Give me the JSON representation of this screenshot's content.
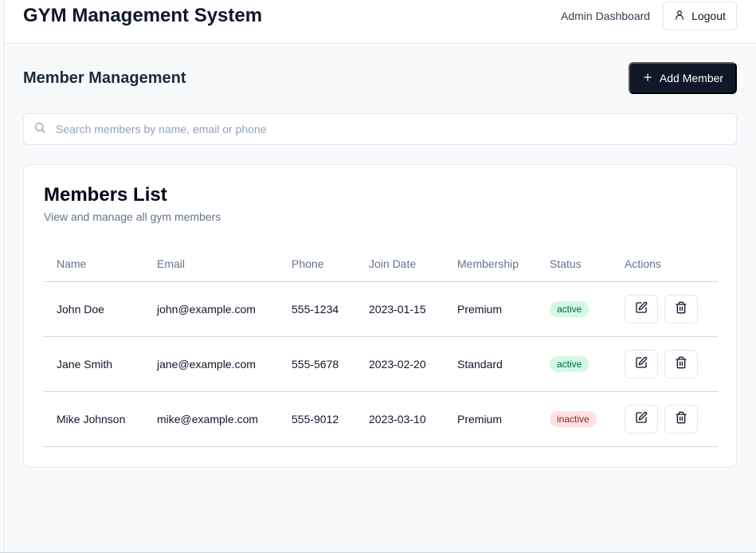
{
  "header": {
    "app_title": "GYM Management System",
    "admin_label": "Admin Dashboard",
    "logout_label": "Logout"
  },
  "page": {
    "title": "Member Management",
    "add_member_label": "Add Member"
  },
  "search": {
    "placeholder": "Search members by name, email or phone",
    "value": ""
  },
  "members_card": {
    "title": "Members List",
    "subtitle": "View and manage all gym members",
    "columns": [
      "Name",
      "Email",
      "Phone",
      "Join Date",
      "Membership",
      "Status",
      "Actions"
    ],
    "rows": [
      {
        "name": "John Doe",
        "email": "john@example.com",
        "phone": "555-1234",
        "join_date": "2023-01-15",
        "membership": "Premium",
        "status": "active"
      },
      {
        "name": "Jane Smith",
        "email": "jane@example.com",
        "phone": "555-5678",
        "join_date": "2023-02-20",
        "membership": "Standard",
        "status": "active"
      },
      {
        "name": "Mike Johnson",
        "email": "mike@example.com",
        "phone": "555-9012",
        "join_date": "2023-03-10",
        "membership": "Premium",
        "status": "inactive"
      }
    ]
  },
  "icons": {
    "logout": "user-icon",
    "add": "plus-icon",
    "search": "search-icon",
    "edit": "edit-icon",
    "delete": "trash-icon"
  },
  "colors": {
    "primary_button": "#111827",
    "active_badge_bg": "#d1fae5",
    "active_badge_text": "#065f46",
    "inactive_badge_bg": "#fee2e2",
    "inactive_badge_text": "#991b1b"
  }
}
